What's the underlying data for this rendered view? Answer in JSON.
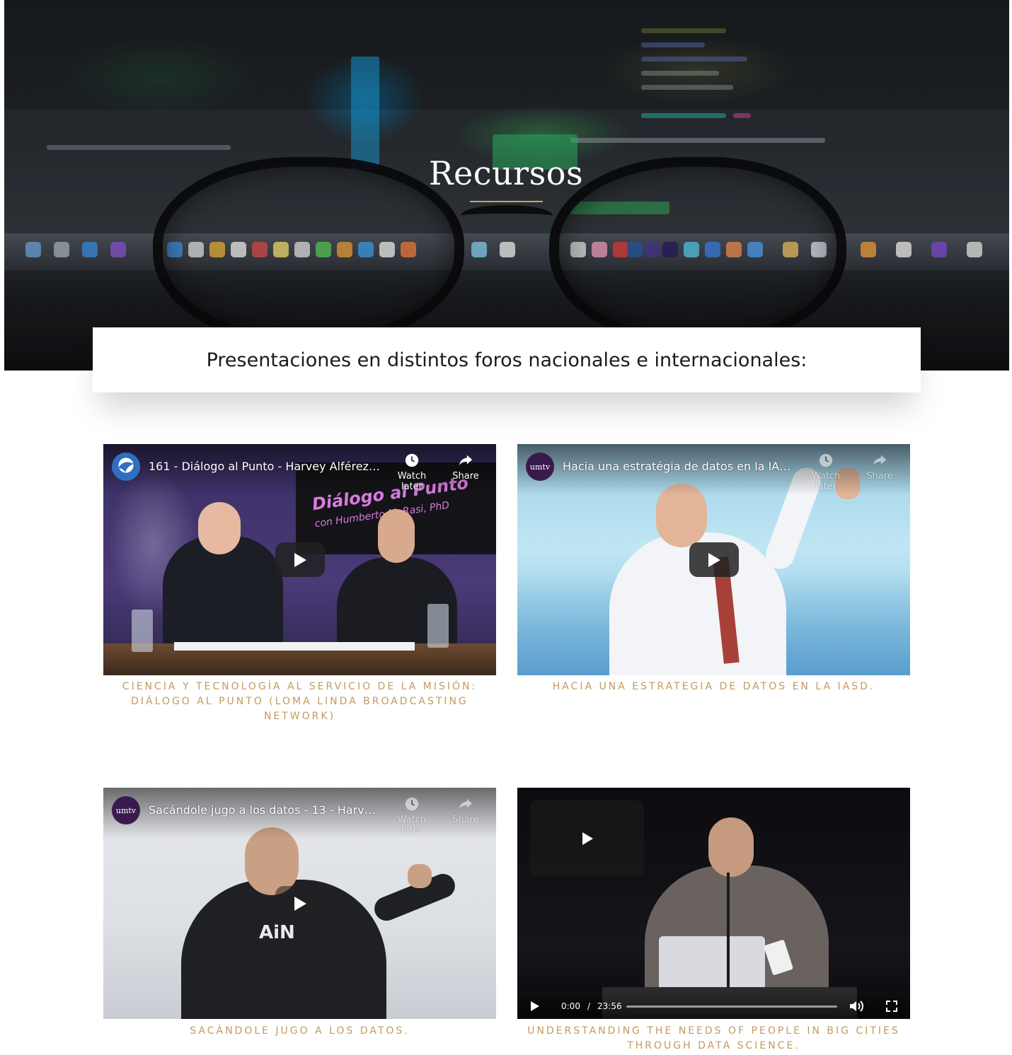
{
  "hero": {
    "title": "Recursos"
  },
  "section": {
    "heading": "Presentaciones en distintos foros nacionales e internacionales:"
  },
  "videos": [
    {
      "title": "161 - Diálogo al Punto - Harvey Alférez…",
      "watch_later": "Watch later",
      "share": "Share",
      "overlay_text_1": "Diálogo al Punto",
      "overlay_text_2": "con Humberto M. Rasi, PhD",
      "caption": "Ciencia y tecnología al servicio de la misión: Diálogo al Punto (Loma Linda Broadcasting Network)"
    },
    {
      "title": "Hacia una estratégia de datos en la IA…",
      "channel_logo": "umtv",
      "watch_later": "Watch later",
      "share": "Share",
      "caption": "Hacia una estrategia de datos en la IASD."
    },
    {
      "title": "Sacándole jugo a los datos - 13 - Harv…",
      "channel_logo": "umtv",
      "watch_later": "Watch later",
      "share": "Share",
      "caption": "Sacándole jugo a los datos."
    },
    {
      "current_time": "0:00",
      "separator": "/",
      "duration": "23:56",
      "caption": "Understanding the needs of people in big cities through data science."
    }
  ],
  "icons": [
    "play-icon",
    "clock-icon",
    "share-icon",
    "volume-icon",
    "fullscreen-icon",
    "channel-logo"
  ],
  "colors": {
    "accent": "#c39a5f",
    "divider": "#c8a16a"
  }
}
